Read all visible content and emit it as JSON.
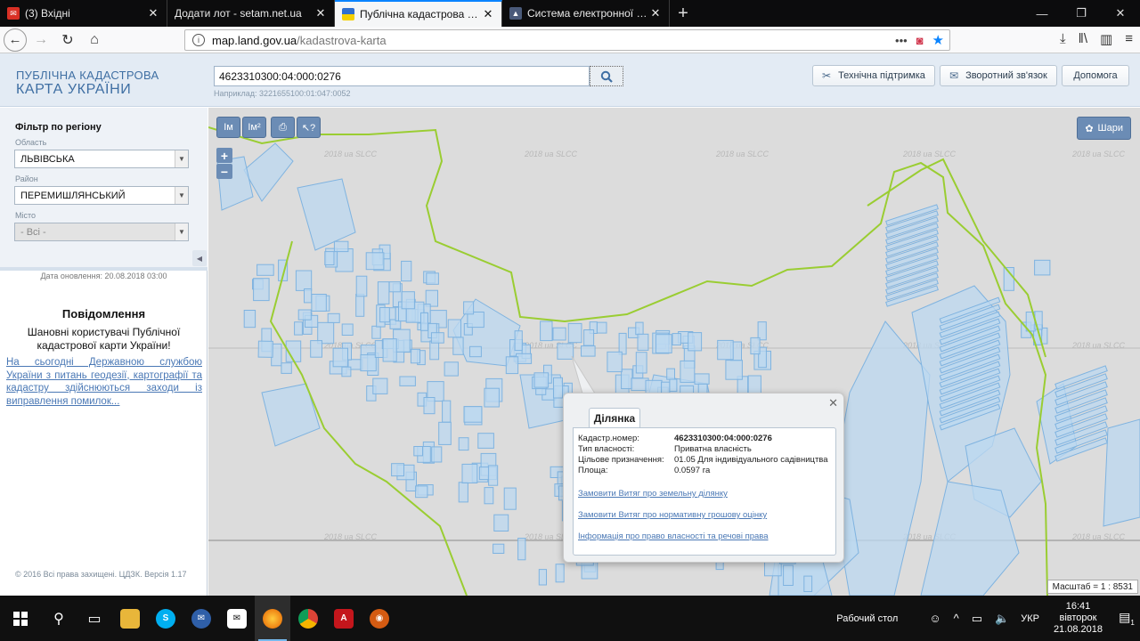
{
  "browser": {
    "tabs": [
      {
        "title": "(3) Вхідні",
        "icon": "mail-icon"
      },
      {
        "title": "Додати лот - setam.net.ua",
        "icon": "page-icon"
      },
      {
        "title": "Публічна кадастрова карта України",
        "icon": "ua-flag-icon"
      },
      {
        "title": "Система електронної пошти",
        "icon": "shield-icon"
      }
    ],
    "active_tab": 2,
    "url_host": "map.land.gov.ua",
    "url_path": "/kadastrova-karta"
  },
  "header": {
    "logo_line1": "ПУБЛІЧНА КАДАСТРОВА",
    "logo_line2": "КАРТА УКРАЇНИ",
    "search_value": "4623310300:04:000:0276",
    "search_hint": "Наприклад: 3221655100:01:047:0052",
    "buttons": {
      "support": "Технічна підтримка",
      "feedback": "Зворотний зв'язок",
      "help": "Допомога"
    }
  },
  "filter": {
    "title": "Фільтр по регіону",
    "oblast_label": "Область",
    "oblast_value": "ЛЬВІВСЬКА",
    "rayon_label": "Район",
    "rayon_value": "ПЕРЕМИШЛЯНСЬКИЙ",
    "city_label": "Місто",
    "city_value": "- Всі -"
  },
  "sidebar": {
    "updated": "Дата оновлення: 20.08.2018 03:00",
    "message_title": "Повідомлення",
    "message_text": "Шановні користувачі Публічної кадастрової карти України!",
    "message_link": "На сьогодні Державною службою України з питань геодезії, картографії та кадастру здійснюються заходи із виправлення помилок...",
    "copyright": "© 2016 Всі права захищені. ЦДЗК. Версія 1.17"
  },
  "map": {
    "tools": [
      "Iм",
      "Iм²"
    ],
    "layers_label": "Шари",
    "scale": "Масштаб = 1 : 8531",
    "watermark": "2018 ua SLCC"
  },
  "popup": {
    "tab": "Ділянка",
    "rows": [
      {
        "k": "Кадастр.номер:",
        "v": "4623310300:04:000:0276"
      },
      {
        "k": "Тип власності:",
        "v": "Приватна власність"
      },
      {
        "k": "Цільове призначення:",
        "v": "01.05 Для індивідуального садівництва"
      },
      {
        "k": "Площа:",
        "v": "0.0597 га"
      }
    ],
    "links": [
      "Замовити Витяг про земельну ділянку",
      "Замовити Витяг про нормативну грошову оцінку",
      "Інформація про право власності та речові права"
    ]
  },
  "taskbar": {
    "desktop_label": "Рабочий стол",
    "lang": "УКР",
    "time": "16:41",
    "day": "вівторок",
    "date": "21.08.2018",
    "notifications": "1"
  },
  "colors": {
    "parcel_fill": "#bcd8f0",
    "parcel_stroke": "#7fb3e0",
    "boundary": "#9acd32",
    "accent": "#0a84ff"
  }
}
